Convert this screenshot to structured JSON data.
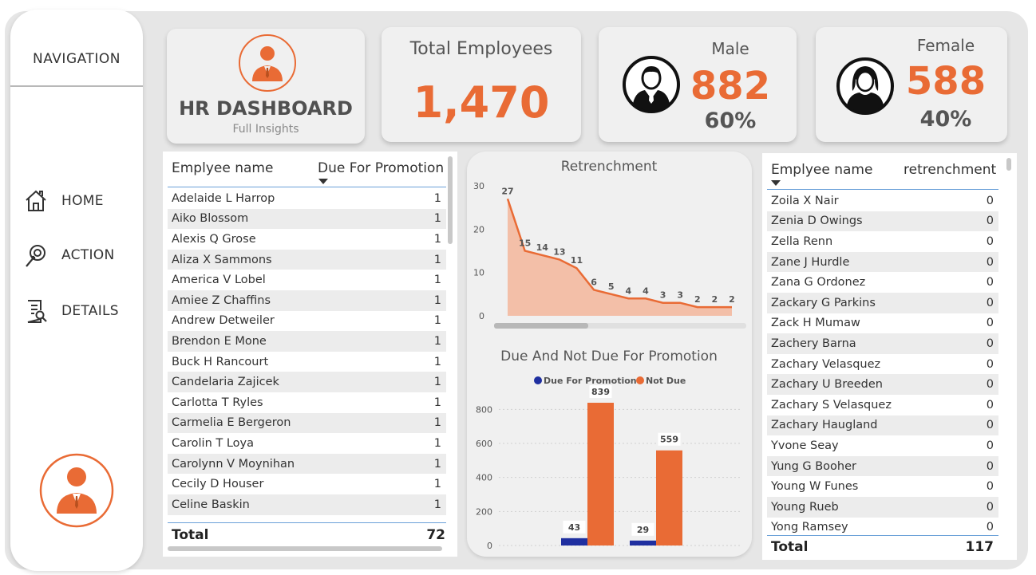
{
  "navigation": {
    "title": "NAVIGATION",
    "items": [
      {
        "label": "HOME",
        "icon": "home-icon"
      },
      {
        "label": "ACTION",
        "icon": "action-icon"
      },
      {
        "label": "DETAILS",
        "icon": "details-icon"
      }
    ]
  },
  "header": {
    "title": "HR DASHBOARD",
    "subtitle": "Full Insights"
  },
  "kpis": {
    "total": {
      "label": "Total Employees",
      "value": "1,470"
    },
    "male": {
      "label": "Male",
      "value": "882",
      "pct": "60%"
    },
    "female": {
      "label": "Female",
      "value": "588",
      "pct": "40%"
    }
  },
  "colors": {
    "accent": "#e96b35",
    "due": "#1f2fa0",
    "area_fill": "#f3b9a0"
  },
  "promotion_table": {
    "columns": [
      "Emplyee name",
      "Due For Promotion"
    ],
    "rows": [
      [
        "Adelaide L Harrop",
        "1"
      ],
      [
        "Aiko Blossom",
        "1"
      ],
      [
        "Alexis Q Grose",
        "1"
      ],
      [
        "Aliza X Sammons",
        "1"
      ],
      [
        "America V Lobel",
        "1"
      ],
      [
        "Amiee Z Chaffins",
        "1"
      ],
      [
        "Andrew Detweiler",
        "1"
      ],
      [
        "Brendon E Mone",
        "1"
      ],
      [
        "Buck H Rancourt",
        "1"
      ],
      [
        "Candelaria Zajicek",
        "1"
      ],
      [
        "Carlotta T Ryles",
        "1"
      ],
      [
        "Carmelia E Bergeron",
        "1"
      ],
      [
        "Carolin T Loya",
        "1"
      ],
      [
        "Carolynn V Moynihan",
        "1"
      ],
      [
        "Cecily D Houser",
        "1"
      ],
      [
        "Celine Baskin",
        "1"
      ]
    ],
    "total_label": "Total",
    "total_value": "72"
  },
  "retrenchment_table": {
    "columns": [
      "Emplyee name",
      "retrenchment"
    ],
    "rows": [
      [
        "Zoila X Nair",
        "0"
      ],
      [
        "Zenia D Owings",
        "0"
      ],
      [
        "Zella Renn",
        "0"
      ],
      [
        "Zane J Hurdle",
        "0"
      ],
      [
        "Zana G Ordonez",
        "0"
      ],
      [
        "Zackary G Parkins",
        "0"
      ],
      [
        "Zack H Mumaw",
        "0"
      ],
      [
        "Zachery Barna",
        "0"
      ],
      [
        "Zachary Velasquez",
        "0"
      ],
      [
        "Zachary U Breeden",
        "0"
      ],
      [
        "Zachary S Velasquez",
        "0"
      ],
      [
        "Zachary Haugland",
        "0"
      ],
      [
        "Yvone Seay",
        "0"
      ],
      [
        "Yung G Booher",
        "0"
      ],
      [
        "Young W Funes",
        "0"
      ],
      [
        "Young Rueb",
        "0"
      ],
      [
        "Yong Ramsey",
        "0"
      ]
    ],
    "total_label": "Total",
    "total_value": "117"
  },
  "chart_data": [
    {
      "type": "area",
      "title": "Retrenchment",
      "values": [
        27,
        15,
        14,
        13,
        11,
        6,
        5,
        4,
        4,
        3,
        3,
        2,
        2,
        2
      ],
      "ylim": [
        0,
        30
      ],
      "yticks": [
        0,
        10,
        20,
        30
      ],
      "grid": false
    },
    {
      "type": "bar",
      "title": "Due And Not Due For Promotion",
      "legend_position": "top",
      "series": [
        {
          "name": "Due For Promotion",
          "values": [
            43,
            29
          ]
        },
        {
          "name": "Not Due",
          "values": [
            839,
            559
          ]
        }
      ],
      "ylim": [
        0,
        900
      ],
      "yticks": [
        0,
        200,
        400,
        600,
        800
      ]
    }
  ]
}
